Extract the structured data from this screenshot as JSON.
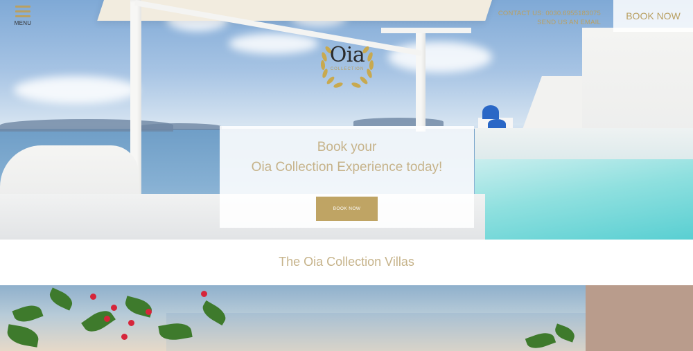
{
  "header": {
    "menu_label": "MENU",
    "contact_line": "CONTACT US: 0030.6955183075",
    "email_link": "SEND US AN EMAIL",
    "book_now_label": "BOOK NOW"
  },
  "logo": {
    "name": "Oia",
    "subtitle": "COLLECTION"
  },
  "promo": {
    "line1": "Book your",
    "line2": "Oia Collection Experience today!",
    "button_label": "BOOK NOW"
  },
  "section": {
    "title": "The Oia Collection Villas"
  },
  "colors": {
    "accent_gold": "#bfa464",
    "text_gold": "#c6b38a"
  },
  "icons": {
    "menu": "hamburger-icon",
    "logo_emblem": "laurel-wreath-icon"
  }
}
